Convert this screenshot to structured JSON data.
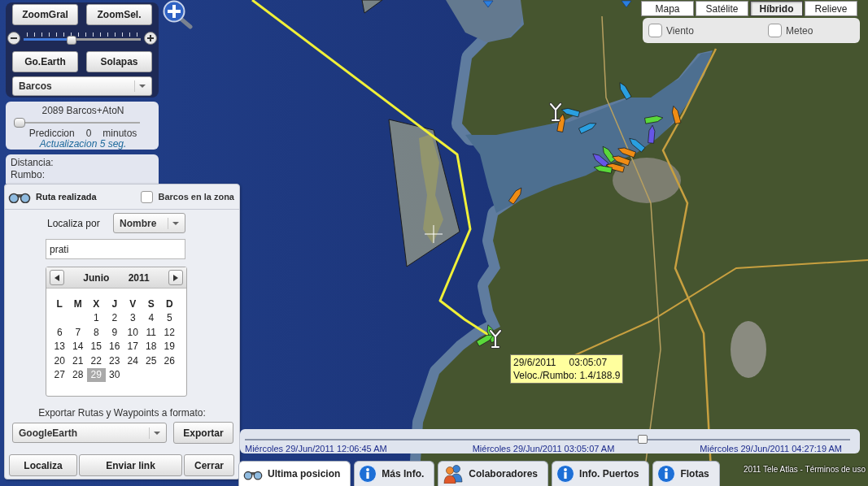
{
  "nav_panel": {
    "buttons": [
      "ZoomGral",
      "ZoomSel.",
      "Go.Earth",
      "Solapas"
    ],
    "zoom_slider": {
      "level": 0.4
    },
    "layer_select": {
      "value": "Barcos"
    }
  },
  "prediction_panel": {
    "count": "2089 Barcos+AtoN",
    "slider": {
      "level": 0
    },
    "label": "Prediccion",
    "value": "0",
    "unit": "minutos",
    "refresh": "Actualizacion 5 seg."
  },
  "measure_panel": {
    "lines": [
      "Distancia:",
      "Rumbo:"
    ]
  },
  "route_panel": {
    "title": "Ruta realizada",
    "zone_checkbox": {
      "label": "Barcos en la zona",
      "checked": false
    },
    "search_label": "Localiza por",
    "search_by": {
      "value": "Nombre"
    },
    "search_field": {
      "value": "prati"
    },
    "calendar": {
      "month": "Junio",
      "year": "2011",
      "weekdays": [
        "L",
        "M",
        "X",
        "J",
        "V",
        "S",
        "D"
      ],
      "weeks": [
        [
          {
            "day": "1",
            "selected": false
          },
          {
            "day": "2",
            "selected": false
          },
          {
            "day": "3",
            "selected": false
          },
          {
            "day": "4",
            "selected": false
          },
          {
            "day": "5",
            "selected": false
          }
        ],
        [
          {
            "day": "6",
            "selected": false
          },
          {
            "day": "7",
            "selected": false
          },
          {
            "day": "8",
            "selected": false
          },
          {
            "day": "9",
            "selected": false
          },
          {
            "day": "10",
            "selected": false
          },
          {
            "day": "11",
            "selected": false
          },
          {
            "day": "12",
            "selected": false
          }
        ],
        [
          {
            "day": "13",
            "selected": false
          },
          {
            "day": "14",
            "selected": false
          },
          {
            "day": "15",
            "selected": false
          },
          {
            "day": "16",
            "selected": false
          },
          {
            "day": "17",
            "selected": false
          },
          {
            "day": "18",
            "selected": false
          },
          {
            "day": "19",
            "selected": false
          }
        ],
        [
          {
            "day": "20",
            "selected": false
          },
          {
            "day": "21",
            "selected": false
          },
          {
            "day": "22",
            "selected": false
          },
          {
            "day": "23",
            "selected": false
          },
          {
            "day": "24",
            "selected": false
          },
          {
            "day": "25",
            "selected": false
          },
          {
            "day": "26",
            "selected": false
          }
        ],
        [
          {
            "day": "27",
            "selected": false
          },
          {
            "day": "28",
            "selected": false
          },
          {
            "day": "29",
            "selected": true
          },
          {
            "day": "30",
            "selected": false
          }
        ]
      ]
    },
    "export_label": "Exportar Rutas y Waypoints a formato:",
    "export_format": {
      "value": "GoogleEarth"
    },
    "export_button": "Exportar",
    "buttons": [
      "Localiza",
      "Enviar link",
      "Cerrar"
    ]
  },
  "map_types": [
    {
      "label": "Mapa",
      "selected": false
    },
    {
      "label": "Satélite",
      "selected": false
    },
    {
      "label": "Híbrido",
      "selected": true
    },
    {
      "label": "Relieve",
      "selected": false
    }
  ],
  "layers": [
    {
      "label": "Viento",
      "checked": false
    },
    {
      "label": "Meteo",
      "checked": false
    }
  ],
  "map": {
    "vessels": [
      {
        "color": "#2a9fe0"
      },
      {
        "color": "#2a9fe0"
      },
      {
        "color": "#f08c14"
      },
      {
        "color": "#2a9fe0"
      },
      {
        "color": "#f08c14"
      },
      {
        "color": "#5ad83a"
      },
      {
        "color": "#6656e8"
      },
      {
        "color": "#2a9fe0"
      },
      {
        "color": "#f08c14"
      },
      {
        "color": "#5ad83a"
      },
      {
        "color": "#6656e8"
      },
      {
        "color": "#f08c14"
      },
      {
        "color": "#f08c14"
      },
      {
        "color": "#5ad83a"
      },
      {
        "color": "#f08c14"
      },
      {
        "color": "#5ad83a"
      },
      {
        "color": "#5ad83a"
      }
    ],
    "tooltip": {
      "date": "29/6/2011",
      "time": "03:05:07",
      "detail": "Veloc./Rumbo: 1.4/188.9"
    },
    "attribution": "2011 Tele Atlas - Términos de uso"
  },
  "timeline": {
    "level": 0.66,
    "labels": [
      "Miércoles 29/Jun/2011 12:06:45 AM",
      "Miércoles 29/Jun/2011 03:05:07 AM",
      "Miércoles 29/Jun/2011 04:27:19 AM"
    ]
  },
  "tabs": [
    {
      "label": "Ultima posicion",
      "kind": "binoculars",
      "selected": true
    },
    {
      "label": "Más Info.",
      "kind": "info",
      "selected": false
    },
    {
      "label": "Colaboradores",
      "kind": "people",
      "selected": false
    },
    {
      "label": "Info. Puertos",
      "kind": "info",
      "selected": false
    },
    {
      "label": "Flotas",
      "kind": "info",
      "selected": false
    }
  ]
}
